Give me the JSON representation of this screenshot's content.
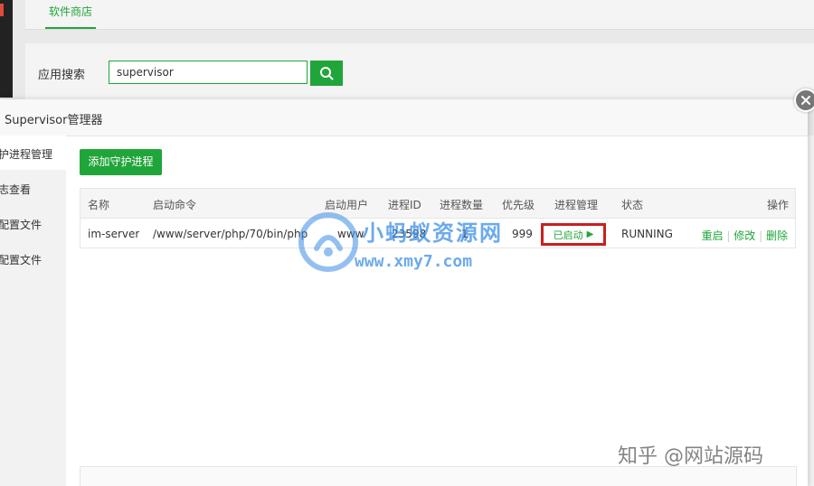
{
  "background": {
    "tab_store": "软件商店",
    "search_label": "应用搜索",
    "search_value": "supervisor"
  },
  "modal": {
    "title": "Supervisor管理器",
    "sidebar": [
      {
        "label": "护进程管理"
      },
      {
        "label": "志查看"
      },
      {
        "label": "配置文件"
      },
      {
        "label": "配置文件"
      }
    ],
    "add_button": "添加守护进程",
    "table": {
      "headers": {
        "name": "名称",
        "command": "启动命令",
        "user": "启动用户",
        "pid": "进程ID",
        "count": "进程数量",
        "priority": "优先级",
        "manage": "进程管理",
        "state": "状态",
        "ops": "操作"
      },
      "row": {
        "name": "im-server",
        "command": "/www/server/php/70/bin/php /w...",
        "user": "www",
        "pid": "23598",
        "count": "1",
        "priority": "999",
        "manage": "已启动",
        "state": "RUNNING",
        "op_restart": "重启",
        "op_edit": "修改",
        "op_delete": "删除"
      }
    }
  },
  "watermarks": {
    "site_name": "小蚂蚁资源网",
    "site_url": "www.xmy7.com",
    "zhihu": "知乎 @网站源码"
  },
  "colors": {
    "accent": "#20a53a",
    "highlight_border": "#c82020"
  }
}
